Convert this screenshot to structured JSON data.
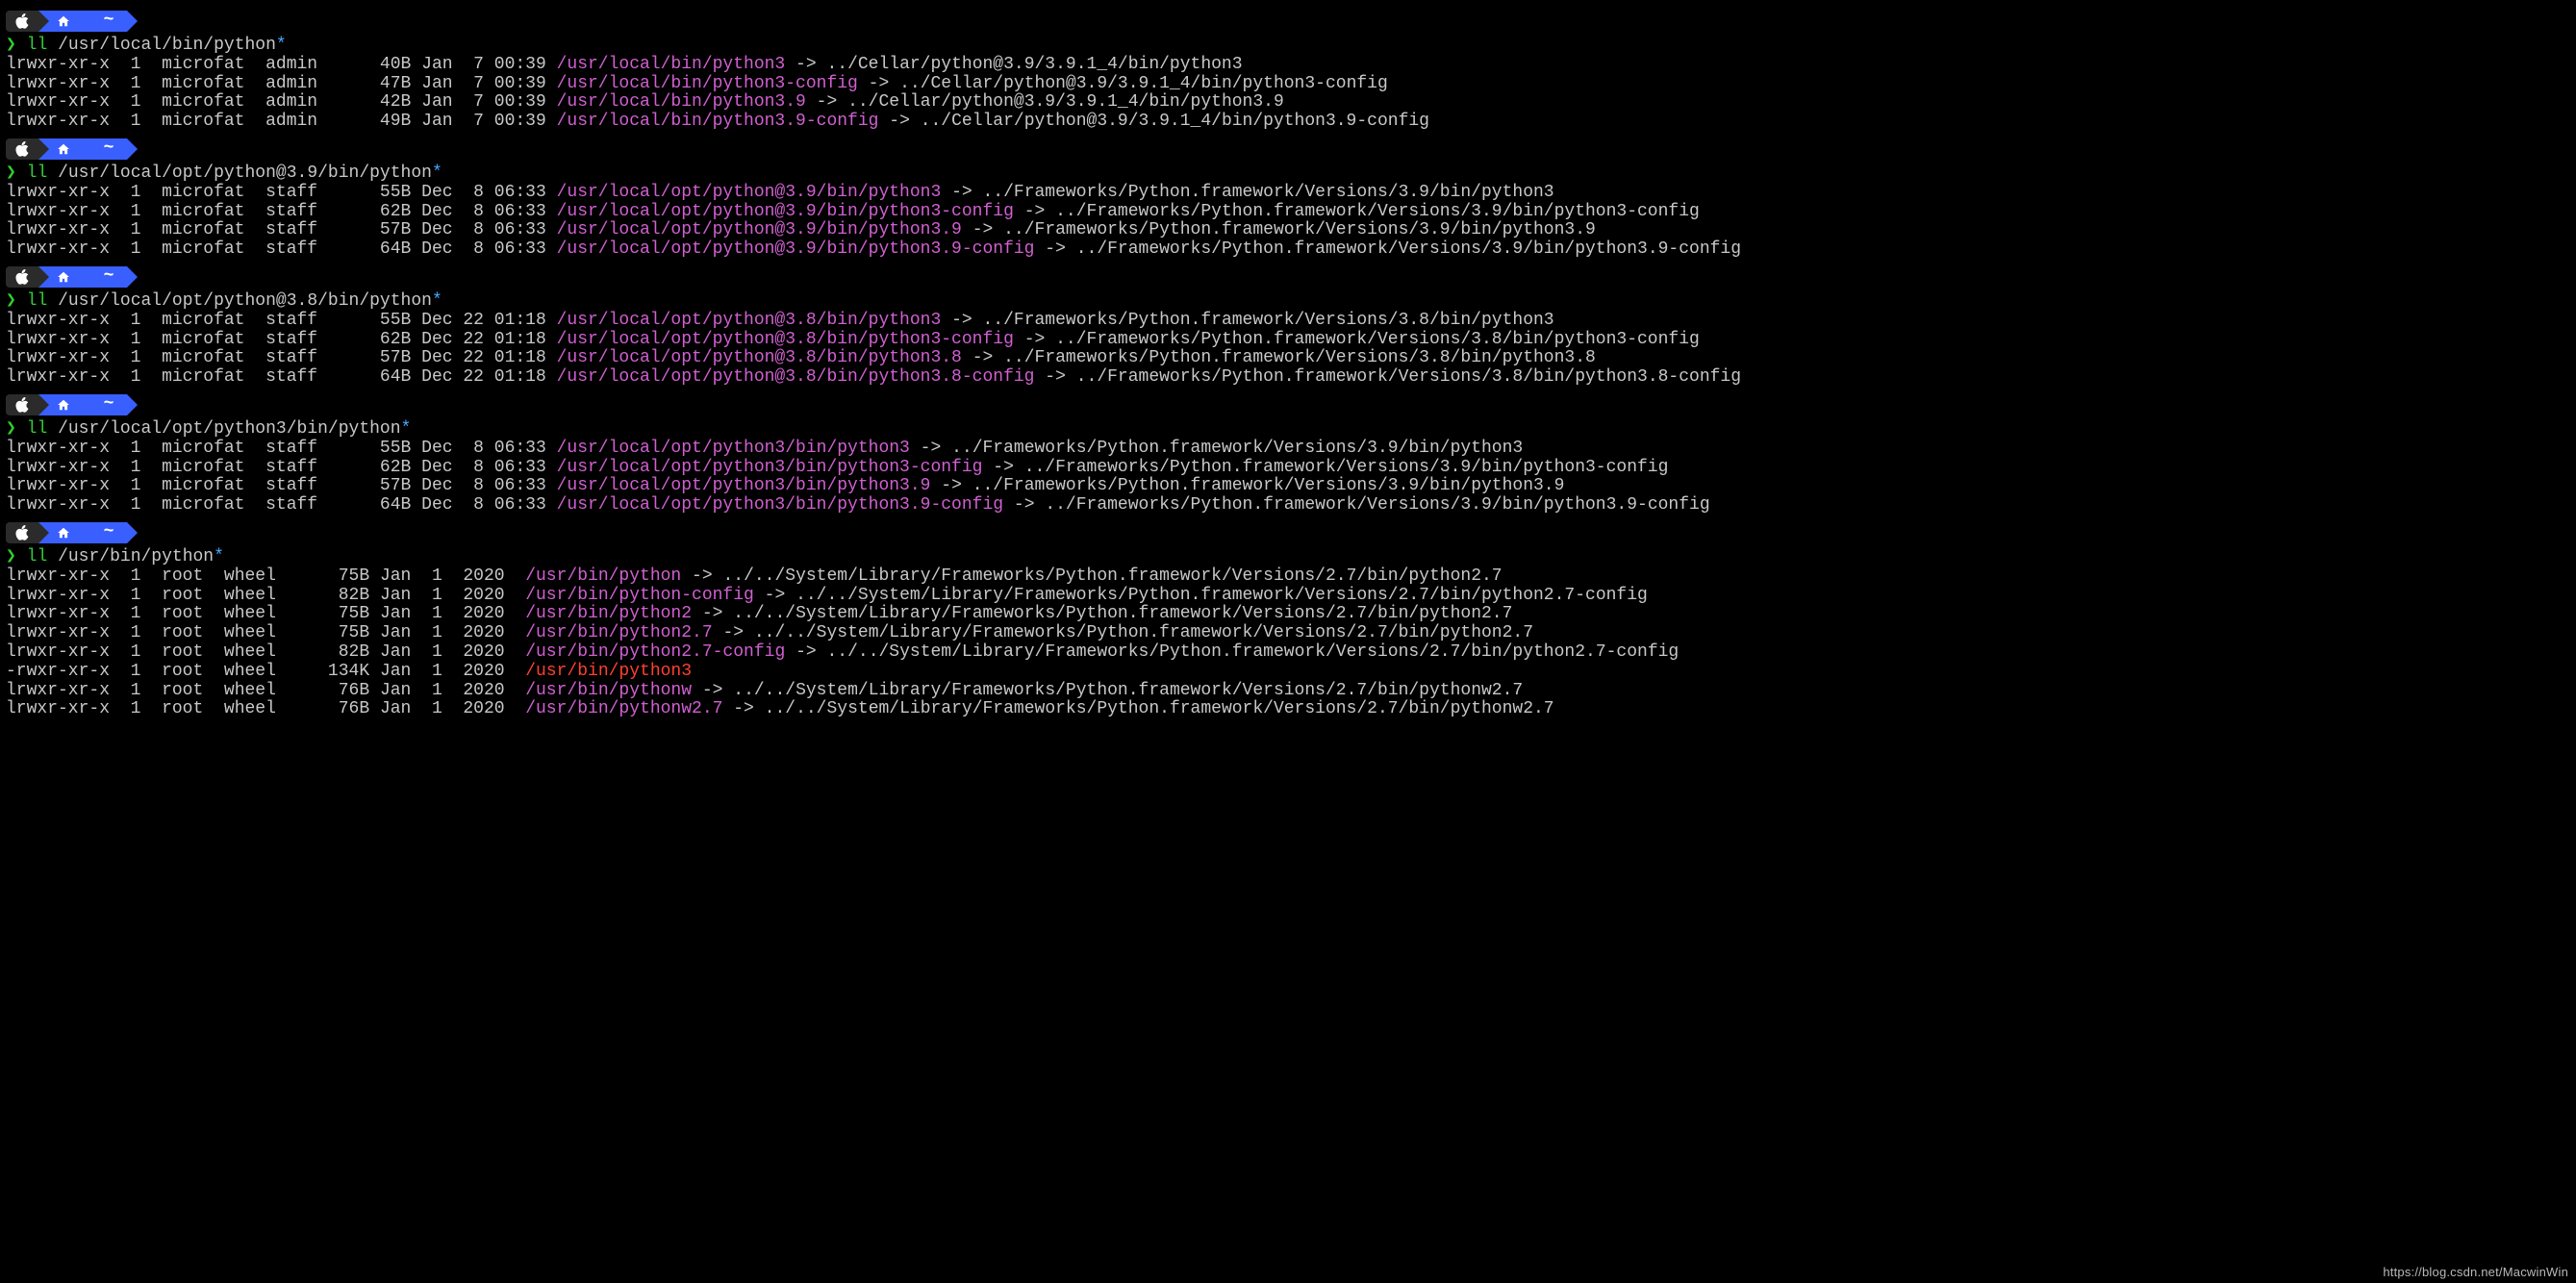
{
  "badge": {
    "tilde": "~"
  },
  "prompt": {
    "chevron": "❯",
    "cmd": "ll"
  },
  "watermark": "https://blog.csdn.net/MacwinWin",
  "blocks": [
    {
      "path_arg": "/usr/local/bin/python",
      "glob": "*",
      "lines": [
        {
          "perms": "lrwxr-xr-x",
          "links": "1",
          "user": "microfat",
          "group": "admin",
          "size": "40B",
          "date": "Jan  7 00:39",
          "name": "/usr/local/bin/python3",
          "exe": false,
          "target": "../Cellar/python@3.9/3.9.1_4/bin/python3"
        },
        {
          "perms": "lrwxr-xr-x",
          "links": "1",
          "user": "microfat",
          "group": "admin",
          "size": "47B",
          "date": "Jan  7 00:39",
          "name": "/usr/local/bin/python3-config",
          "exe": false,
          "target": "../Cellar/python@3.9/3.9.1_4/bin/python3-config"
        },
        {
          "perms": "lrwxr-xr-x",
          "links": "1",
          "user": "microfat",
          "group": "admin",
          "size": "42B",
          "date": "Jan  7 00:39",
          "name": "/usr/local/bin/python3.9",
          "exe": false,
          "target": "../Cellar/python@3.9/3.9.1_4/bin/python3.9"
        },
        {
          "perms": "lrwxr-xr-x",
          "links": "1",
          "user": "microfat",
          "group": "admin",
          "size": "49B",
          "date": "Jan  7 00:39",
          "name": "/usr/local/bin/python3.9-config",
          "exe": false,
          "target": "../Cellar/python@3.9/3.9.1_4/bin/python3.9-config"
        }
      ]
    },
    {
      "path_arg": "/usr/local/opt/python@3.9/bin/python",
      "glob": "*",
      "lines": [
        {
          "perms": "lrwxr-xr-x",
          "links": "1",
          "user": "microfat",
          "group": "staff",
          "size": "55B",
          "date": "Dec  8 06:33",
          "name": "/usr/local/opt/python@3.9/bin/python3",
          "exe": false,
          "target": "../Frameworks/Python.framework/Versions/3.9/bin/python3"
        },
        {
          "perms": "lrwxr-xr-x",
          "links": "1",
          "user": "microfat",
          "group": "staff",
          "size": "62B",
          "date": "Dec  8 06:33",
          "name": "/usr/local/opt/python@3.9/bin/python3-config",
          "exe": false,
          "target": "../Frameworks/Python.framework/Versions/3.9/bin/python3-config"
        },
        {
          "perms": "lrwxr-xr-x",
          "links": "1",
          "user": "microfat",
          "group": "staff",
          "size": "57B",
          "date": "Dec  8 06:33",
          "name": "/usr/local/opt/python@3.9/bin/python3.9",
          "exe": false,
          "target": "../Frameworks/Python.framework/Versions/3.9/bin/python3.9"
        },
        {
          "perms": "lrwxr-xr-x",
          "links": "1",
          "user": "microfat",
          "group": "staff",
          "size": "64B",
          "date": "Dec  8 06:33",
          "name": "/usr/local/opt/python@3.9/bin/python3.9-config",
          "exe": false,
          "target": "../Frameworks/Python.framework/Versions/3.9/bin/python3.9-config"
        }
      ]
    },
    {
      "path_arg": "/usr/local/opt/python@3.8/bin/python",
      "glob": "*",
      "lines": [
        {
          "perms": "lrwxr-xr-x",
          "links": "1",
          "user": "microfat",
          "group": "staff",
          "size": "55B",
          "date": "Dec 22 01:18",
          "name": "/usr/local/opt/python@3.8/bin/python3",
          "exe": false,
          "target": "../Frameworks/Python.framework/Versions/3.8/bin/python3"
        },
        {
          "perms": "lrwxr-xr-x",
          "links": "1",
          "user": "microfat",
          "group": "staff",
          "size": "62B",
          "date": "Dec 22 01:18",
          "name": "/usr/local/opt/python@3.8/bin/python3-config",
          "exe": false,
          "target": "../Frameworks/Python.framework/Versions/3.8/bin/python3-config"
        },
        {
          "perms": "lrwxr-xr-x",
          "links": "1",
          "user": "microfat",
          "group": "staff",
          "size": "57B",
          "date": "Dec 22 01:18",
          "name": "/usr/local/opt/python@3.8/bin/python3.8",
          "exe": false,
          "target": "../Frameworks/Python.framework/Versions/3.8/bin/python3.8"
        },
        {
          "perms": "lrwxr-xr-x",
          "links": "1",
          "user": "microfat",
          "group": "staff",
          "size": "64B",
          "date": "Dec 22 01:18",
          "name": "/usr/local/opt/python@3.8/bin/python3.8-config",
          "exe": false,
          "target": "../Frameworks/Python.framework/Versions/3.8/bin/python3.8-config"
        }
      ]
    },
    {
      "path_arg": "/usr/local/opt/python3/bin/python",
      "glob": "*",
      "lines": [
        {
          "perms": "lrwxr-xr-x",
          "links": "1",
          "user": "microfat",
          "group": "staff",
          "size": "55B",
          "date": "Dec  8 06:33",
          "name": "/usr/local/opt/python3/bin/python3",
          "exe": false,
          "target": "../Frameworks/Python.framework/Versions/3.9/bin/python3"
        },
        {
          "perms": "lrwxr-xr-x",
          "links": "1",
          "user": "microfat",
          "group": "staff",
          "size": "62B",
          "date": "Dec  8 06:33",
          "name": "/usr/local/opt/python3/bin/python3-config",
          "exe": false,
          "target": "../Frameworks/Python.framework/Versions/3.9/bin/python3-config"
        },
        {
          "perms": "lrwxr-xr-x",
          "links": "1",
          "user": "microfat",
          "group": "staff",
          "size": "57B",
          "date": "Dec  8 06:33",
          "name": "/usr/local/opt/python3/bin/python3.9",
          "exe": false,
          "target": "../Frameworks/Python.framework/Versions/3.9/bin/python3.9"
        },
        {
          "perms": "lrwxr-xr-x",
          "links": "1",
          "user": "microfat",
          "group": "staff",
          "size": "64B",
          "date": "Dec  8 06:33",
          "name": "/usr/local/opt/python3/bin/python3.9-config",
          "exe": false,
          "target": "../Frameworks/Python.framework/Versions/3.9/bin/python3.9-config"
        }
      ]
    },
    {
      "path_arg": "/usr/bin/python",
      "glob": "*",
      "lines": [
        {
          "perms": "lrwxr-xr-x",
          "links": "1",
          "user": "root",
          "group": "wheel",
          "size": "75B",
          "date": "Jan  1  2020",
          "name": "/usr/bin/python",
          "exe": false,
          "target": "../../System/Library/Frameworks/Python.framework/Versions/2.7/bin/python2.7"
        },
        {
          "perms": "lrwxr-xr-x",
          "links": "1",
          "user": "root",
          "group": "wheel",
          "size": "82B",
          "date": "Jan  1  2020",
          "name": "/usr/bin/python-config",
          "exe": false,
          "target": "../../System/Library/Frameworks/Python.framework/Versions/2.7/bin/python2.7-config"
        },
        {
          "perms": "lrwxr-xr-x",
          "links": "1",
          "user": "root",
          "group": "wheel",
          "size": "75B",
          "date": "Jan  1  2020",
          "name": "/usr/bin/python2",
          "exe": false,
          "target": "../../System/Library/Frameworks/Python.framework/Versions/2.7/bin/python2.7"
        },
        {
          "perms": "lrwxr-xr-x",
          "links": "1",
          "user": "root",
          "group": "wheel",
          "size": "75B",
          "date": "Jan  1  2020",
          "name": "/usr/bin/python2.7",
          "exe": false,
          "target": "../../System/Library/Frameworks/Python.framework/Versions/2.7/bin/python2.7"
        },
        {
          "perms": "lrwxr-xr-x",
          "links": "1",
          "user": "root",
          "group": "wheel",
          "size": "82B",
          "date": "Jan  1  2020",
          "name": "/usr/bin/python2.7-config",
          "exe": false,
          "target": "../../System/Library/Frameworks/Python.framework/Versions/2.7/bin/python2.7-config"
        },
        {
          "perms": "-rwxr-xr-x",
          "links": "1",
          "user": "root",
          "group": "wheel",
          "size": "134K",
          "date": "Jan  1  2020",
          "name": "/usr/bin/python3",
          "exe": true,
          "target": ""
        },
        {
          "perms": "lrwxr-xr-x",
          "links": "1",
          "user": "root",
          "group": "wheel",
          "size": "76B",
          "date": "Jan  1  2020",
          "name": "/usr/bin/pythonw",
          "exe": false,
          "target": "../../System/Library/Frameworks/Python.framework/Versions/2.7/bin/pythonw2.7"
        },
        {
          "perms": "lrwxr-xr-x",
          "links": "1",
          "user": "root",
          "group": "wheel",
          "size": "76B",
          "date": "Jan  1  2020",
          "name": "/usr/bin/pythonw2.7",
          "exe": false,
          "target": "../../System/Library/Frameworks/Python.framework/Versions/2.7/bin/pythonw2.7"
        }
      ]
    }
  ],
  "col_widths": {
    "std": {
      "perm": 10,
      "links": 2,
      "user": 8,
      "group": 5,
      "size": 7,
      "date": 12
    },
    "short": {
      "perm": 10,
      "links": 2,
      "user": 4,
      "group": 5,
      "size": 7,
      "date": 13
    }
  }
}
